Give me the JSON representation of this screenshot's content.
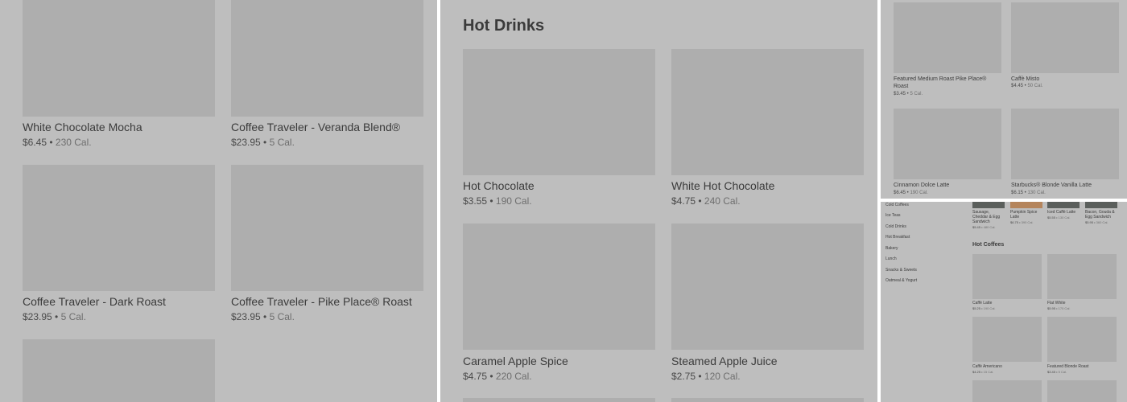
{
  "panel1": {
    "items": [
      {
        "name": "White Chocolate Mocha",
        "price": "$6.45",
        "cal": "230 Cal."
      },
      {
        "name": "Coffee Traveler - Veranda Blend®",
        "price": "$23.95",
        "cal": "5 Cal."
      },
      {
        "name": "Coffee Traveler - Dark Roast",
        "price": "$23.95",
        "cal": "5 Cal."
      },
      {
        "name": "Coffee Traveler - Pike Place® Roast",
        "price": "$23.95",
        "cal": "5 Cal."
      }
    ]
  },
  "panel2": {
    "section_title": "Hot Drinks",
    "items": [
      {
        "name": "Hot Chocolate",
        "price": "$3.55",
        "cal": "190 Cal."
      },
      {
        "name": "White Hot Chocolate",
        "price": "$4.75",
        "cal": "240 Cal."
      },
      {
        "name": "Caramel Apple Spice",
        "price": "$4.75",
        "cal": "220 Cal."
      },
      {
        "name": "Steamed Apple Juice",
        "price": "$2.75",
        "cal": "120 Cal."
      }
    ]
  },
  "panel3": {
    "items": [
      {
        "name": "Featured Medium Roast Pike Place® Roast",
        "price": "$3.45",
        "cal": "5 Cal."
      },
      {
        "name": "Caffè Misto",
        "price": "$4.45",
        "cal": "50 Cal."
      },
      {
        "name": "Cinnamon Dolce Latte",
        "price": "$6.45",
        "cal": "190 Cal."
      },
      {
        "name": "Starbucks® Blonde Vanilla Latte",
        "price": "$6.15",
        "cal": "130 Cal."
      }
    ]
  },
  "panel4": {
    "nav": [
      "Cold Coffees",
      "Ice Teas",
      "Cold Drinks",
      "Hot Breakfast",
      "Bakery",
      "Lunch",
      "Snacks & Sweets",
      "Oatmeal & Yogurt"
    ],
    "top_items": [
      {
        "name": "Sausage, Cheddar & Egg Sandwich",
        "price": "$5.45",
        "cal": "480 Cal."
      },
      {
        "name": "Pumpkin Spice Latte",
        "price": "$6.75",
        "cal": "390 Cal."
      },
      {
        "name": "Iced Caffè Latte",
        "price": "$5.55",
        "cal": "130 Cal."
      },
      {
        "name": "Bacon, Gouda & Egg Sandwich",
        "price": "$5.95",
        "cal": "360 Cal."
      }
    ],
    "section_title": "Hot Coffees",
    "items": [
      {
        "name": "Caffè Latte",
        "price": "$5.25",
        "cal": "190 Cal."
      },
      {
        "name": "Flat White",
        "price": "$5.95",
        "cal": "170 Cal."
      },
      {
        "name": "Caffè Americano",
        "price": "$4.25",
        "cal": "15 Cal."
      },
      {
        "name": "Featured Blonde Roast",
        "price": "$3.45",
        "cal": "5 Cal."
      }
    ]
  }
}
